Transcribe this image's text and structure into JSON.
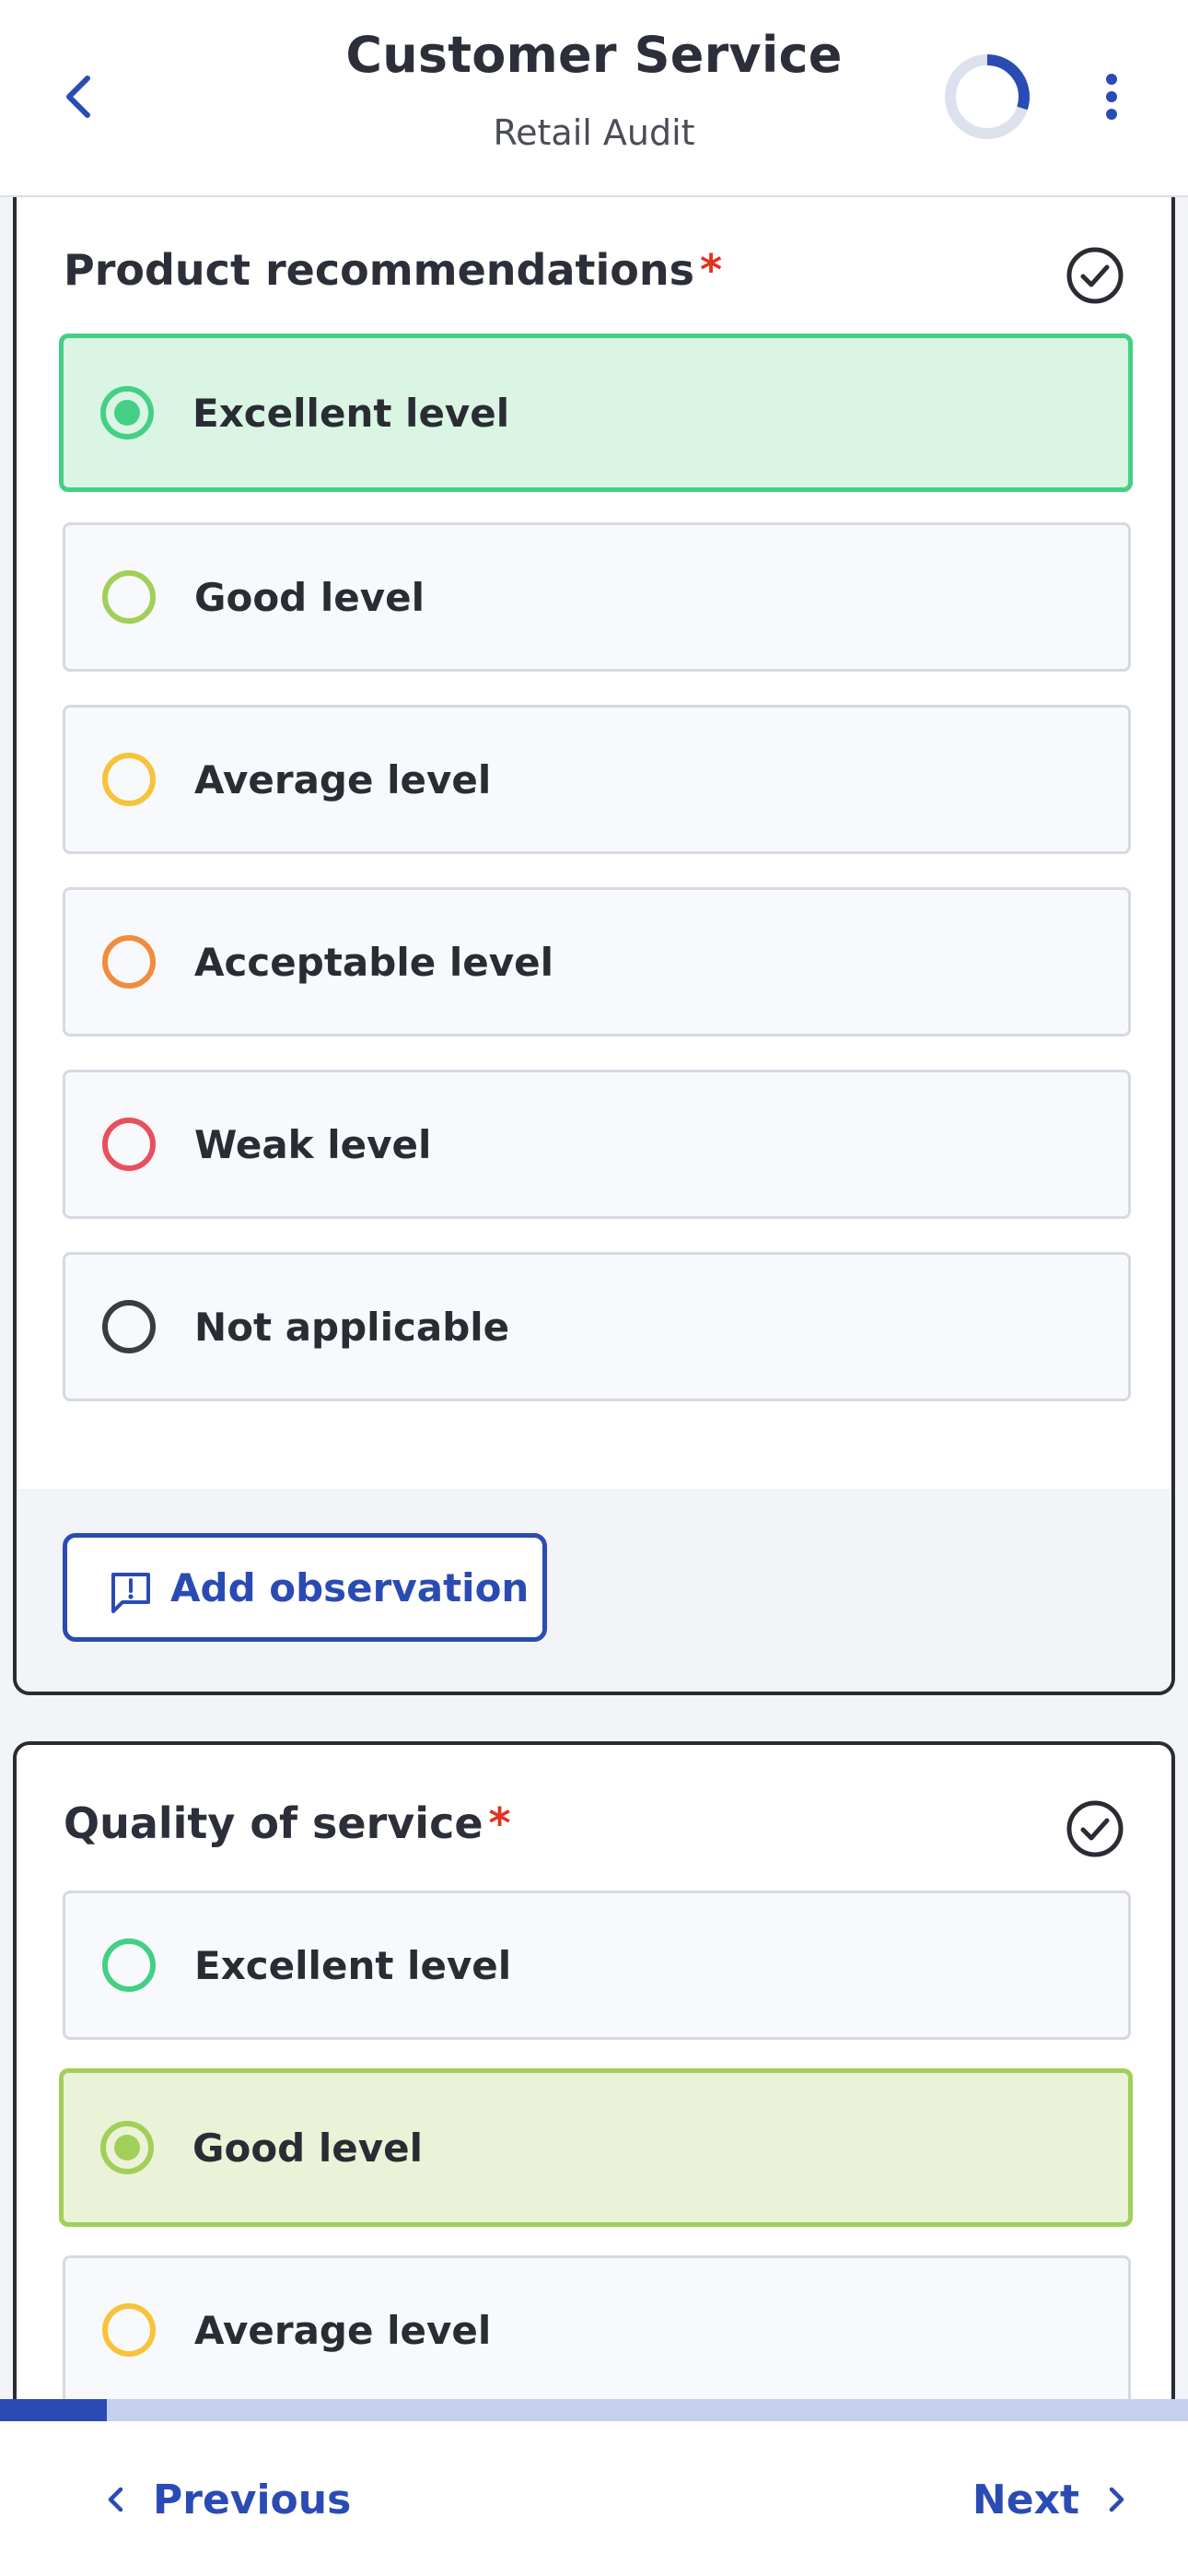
{
  "header": {
    "title": "Customer Service",
    "subtitle": "Retail Audit",
    "progress_fraction": 0.3
  },
  "questions": [
    {
      "title": "Product recommendations",
      "required_mark": "*",
      "selected_index": 0,
      "options": [
        {
          "label": "Excellent level",
          "color": "#44d084"
        },
        {
          "label": "Good level",
          "color": "#a2cf5a"
        },
        {
          "label": "Average level",
          "color": "#f6c33a"
        },
        {
          "label": "Acceptable level",
          "color": "#f18c3e"
        },
        {
          "label": "Weak level",
          "color": "#e9505c"
        },
        {
          "label": "Not applicable",
          "color": "#3a3c42"
        }
      ],
      "observation_button": "Add observation"
    },
    {
      "title": "Quality of service",
      "required_mark": "*",
      "selected_index": 1,
      "options": [
        {
          "label": "Excellent level",
          "color": "#44d084"
        },
        {
          "label": "Good level",
          "color": "#a2cf5a"
        },
        {
          "label": "Average level",
          "color": "#f6c33a"
        }
      ]
    }
  ],
  "bottom_progress_fraction": 0.09,
  "footer": {
    "previous_label": "Previous",
    "next_label": "Next"
  },
  "colors": {
    "accent": "#2b4bb4",
    "required": "#e0341e"
  }
}
